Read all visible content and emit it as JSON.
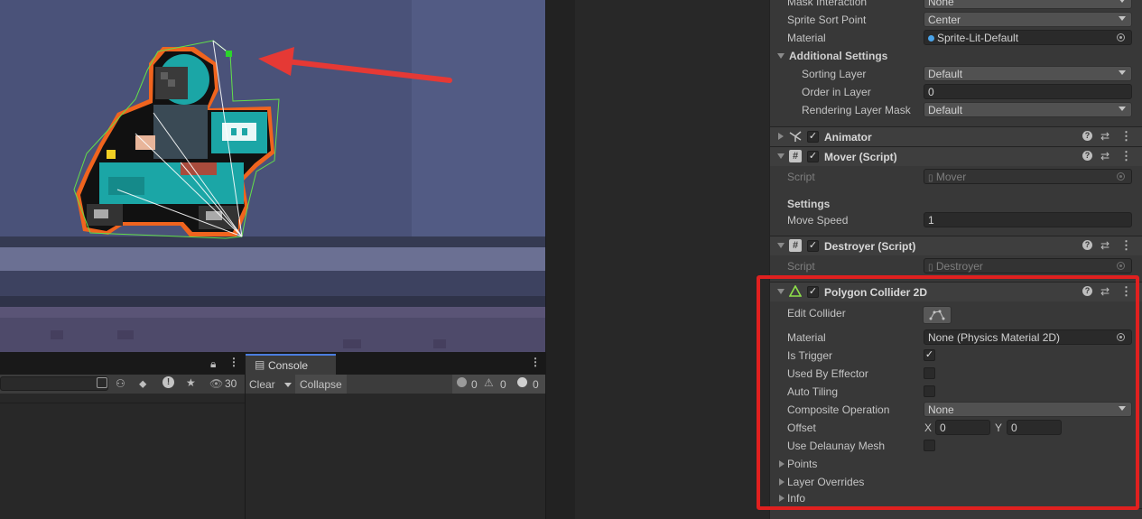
{
  "scene": {
    "colors": {
      "background": "#4a5279",
      "floor": "#353a52",
      "accent": "#e53935",
      "collider": "#63e04a"
    }
  },
  "hierarchy": {
    "search_value": "",
    "visible_count": "30"
  },
  "console": {
    "tab_label": "Console",
    "clear_label": "Clear",
    "collapse_label": "Collapse",
    "log_count": "0",
    "warning_count": "0",
    "error_count": "0"
  },
  "inspector": {
    "sprite_renderer": {
      "mask_interaction_label": "Mask Interaction",
      "mask_interaction_value": "None",
      "sprite_sort_point_label": "Sprite Sort Point",
      "sprite_sort_point_value": "Center",
      "material_label": "Material",
      "material_value": "Sprite-Lit-Default",
      "additional_settings_label": "Additional Settings",
      "sorting_layer_label": "Sorting Layer",
      "sorting_layer_value": "Default",
      "order_in_layer_label": "Order in Layer",
      "order_in_layer_value": "0",
      "rendering_layer_mask_label": "Rendering Layer Mask",
      "rendering_layer_mask_value": "Default"
    },
    "animator": {
      "title": "Animator"
    },
    "mover": {
      "title": "Mover (Script)",
      "script_label": "Script",
      "script_value": "Mover",
      "settings_header": "Settings",
      "move_speed_label": "Move Speed",
      "move_speed_value": "1"
    },
    "destroyer": {
      "title": "Destroyer (Script)",
      "script_label": "Script",
      "script_value": "Destroyer"
    },
    "polygon_collider": {
      "title": "Polygon Collider 2D",
      "edit_collider_label": "Edit Collider",
      "material_label": "Material",
      "material_value": "None (Physics Material 2D)",
      "is_trigger_label": "Is Trigger",
      "is_trigger_checked": true,
      "used_by_effector_label": "Used By Effector",
      "auto_tiling_label": "Auto Tiling",
      "composite_operation_label": "Composite Operation",
      "composite_operation_value": "None",
      "offset_label": "Offset",
      "offset_x_label": "X",
      "offset_x_value": "0",
      "offset_y_label": "Y",
      "offset_y_value": "0",
      "use_delaunay_mesh_label": "Use Delaunay Mesh",
      "points_label": "Points",
      "layer_overrides_label": "Layer Overrides",
      "info_label": "Info"
    },
    "checkmark": "✓",
    "help_glyph": "?",
    "preset_glyph": "⇄",
    "kebab_glyph": "⋮"
  },
  "highlight_color": "#e0201f"
}
